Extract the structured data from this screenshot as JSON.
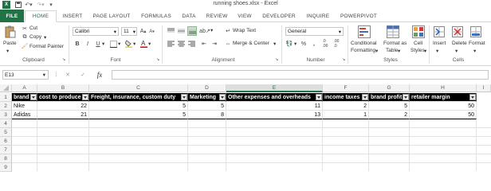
{
  "window": {
    "title": "running shoes.xlsx - Excel"
  },
  "tabs": [
    "FILE",
    "HOME",
    "INSERT",
    "PAGE LAYOUT",
    "FORMULAS",
    "DATA",
    "REVIEW",
    "VIEW",
    "DEVELOPER",
    "INQUIRE",
    "POWERPIVOT"
  ],
  "ribbon": {
    "clipboard": {
      "paste": "Paste",
      "cut": "Cut",
      "copy": "Copy",
      "format_painter": "Format Painter",
      "label": "Clipboard"
    },
    "font": {
      "name": "Calibri",
      "size": "11",
      "label": "Font"
    },
    "alignment": {
      "wrap": "Wrap Text",
      "merge": "Merge & Center",
      "label": "Alignment"
    },
    "number": {
      "format": "General",
      "label": "Number"
    },
    "styles": {
      "cond1": "Conditional",
      "cond2": "Formatting",
      "fmt1": "Format as",
      "fmt2": "Table",
      "cell1": "Cell",
      "cell2": "Styles",
      "label": "Styles"
    },
    "cells": {
      "insert": "Insert",
      "delete": "Delete",
      "format": "Format",
      "label": "Cells"
    }
  },
  "formula_bar": {
    "name_box": "E13",
    "fx": "fx",
    "content": ""
  },
  "columns": [
    "A",
    "B",
    "C",
    "D",
    "E",
    "F",
    "G",
    "H",
    "I"
  ],
  "rows": [
    "1",
    "2",
    "3",
    "4",
    "5",
    "6",
    "7",
    "8",
    "9"
  ],
  "table": {
    "headers": [
      "brand",
      "cost to produce",
      "Freight, insurance, custom duty",
      "Marketing",
      "Other expenses and overheads",
      "income taxes",
      "brand  profit",
      "retailer margin"
    ],
    "data": [
      [
        "Nike",
        "22",
        "5",
        "5",
        "11",
        "2",
        "5",
        "50"
      ],
      [
        "Adidas",
        "21",
        "5",
        "8",
        "13",
        "1",
        "2",
        "50"
      ]
    ]
  },
  "colors": {
    "excel_green": "#217346",
    "header_bg": "#000000",
    "header_text": "#ffffff"
  }
}
